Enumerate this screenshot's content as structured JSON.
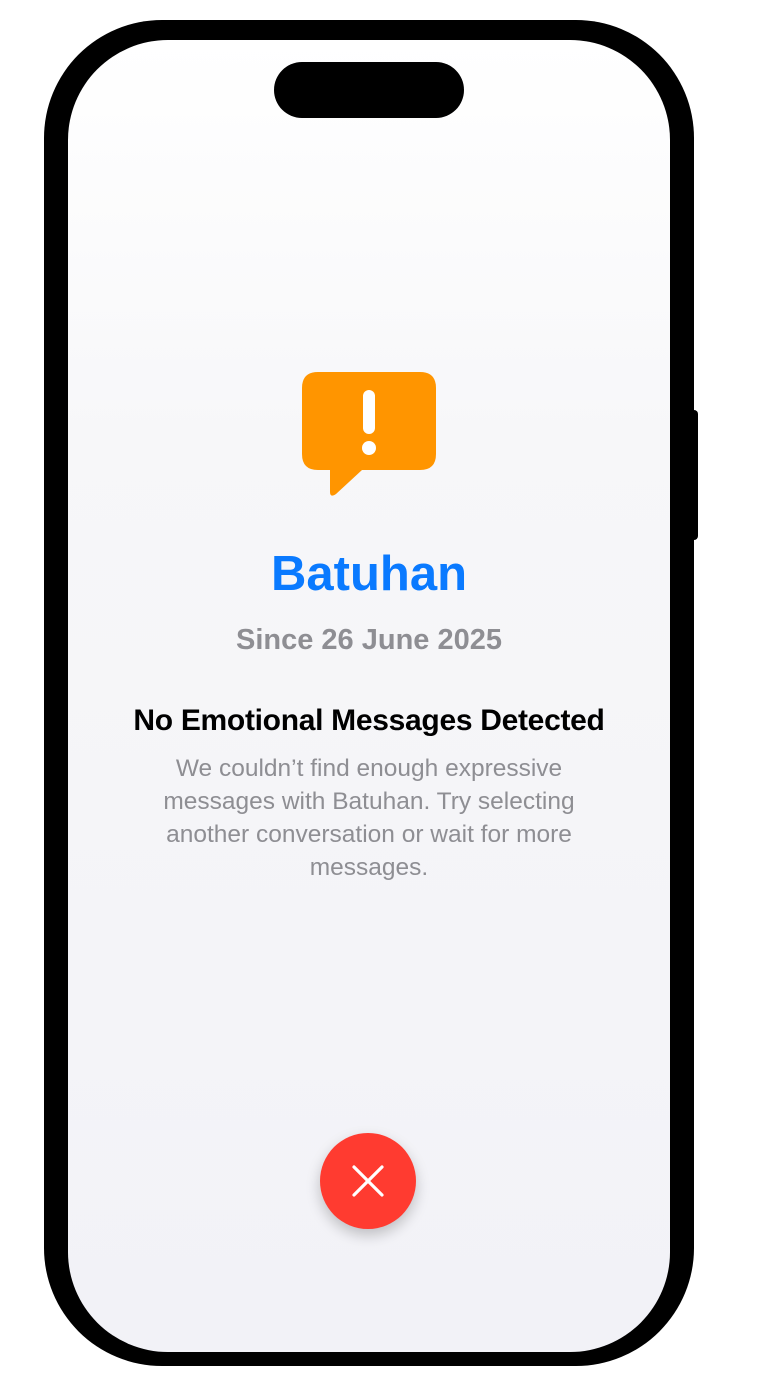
{
  "contact": {
    "name": "Batuhan",
    "since": "Since 26 June 2025"
  },
  "empty_state": {
    "title": "No Emotional Messages Detected",
    "message": "We couldn’t find enough expressive messages with Batuhan. Try selecting another conversation or wait for more messages."
  },
  "icons": {
    "alert": "exclamation-bubble-icon",
    "close": "close-icon"
  },
  "colors": {
    "accent_blue": "#0a7aff",
    "alert_orange": "#ff9500",
    "close_red": "#ff3b30",
    "secondary_gray": "#8e8e93"
  }
}
